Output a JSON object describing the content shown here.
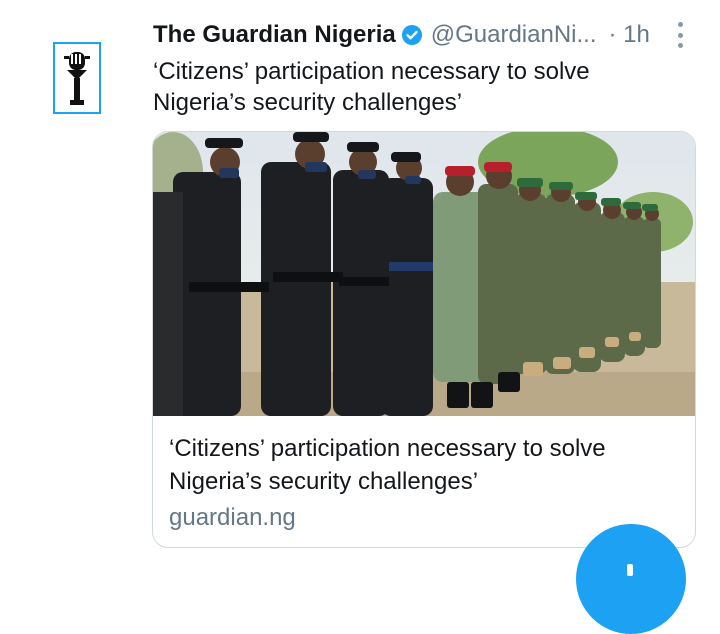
{
  "tweet": {
    "display_name": "The Guardian Nigeria",
    "handle": "@GuardianNi...",
    "timestamp": "· 1h",
    "text": "‘Citizens’ participation necessary to solve Nigeria’s security challenges’",
    "verified": true,
    "avatar_icon": "guardian-logo-icon",
    "menu_icon": "more-vertical-icon"
  },
  "card": {
    "image_icon": "uniformed-officers-photo",
    "title": "‘Citizens’ participation necessary to solve Nigeria’s security challenges’",
    "domain": "guardian.ng"
  },
  "fab": {
    "icon": "plus-icon"
  },
  "colors": {
    "accent": "#1da1f2",
    "text": "#14171a",
    "muted": "#657786",
    "border": "#cfd9de"
  }
}
